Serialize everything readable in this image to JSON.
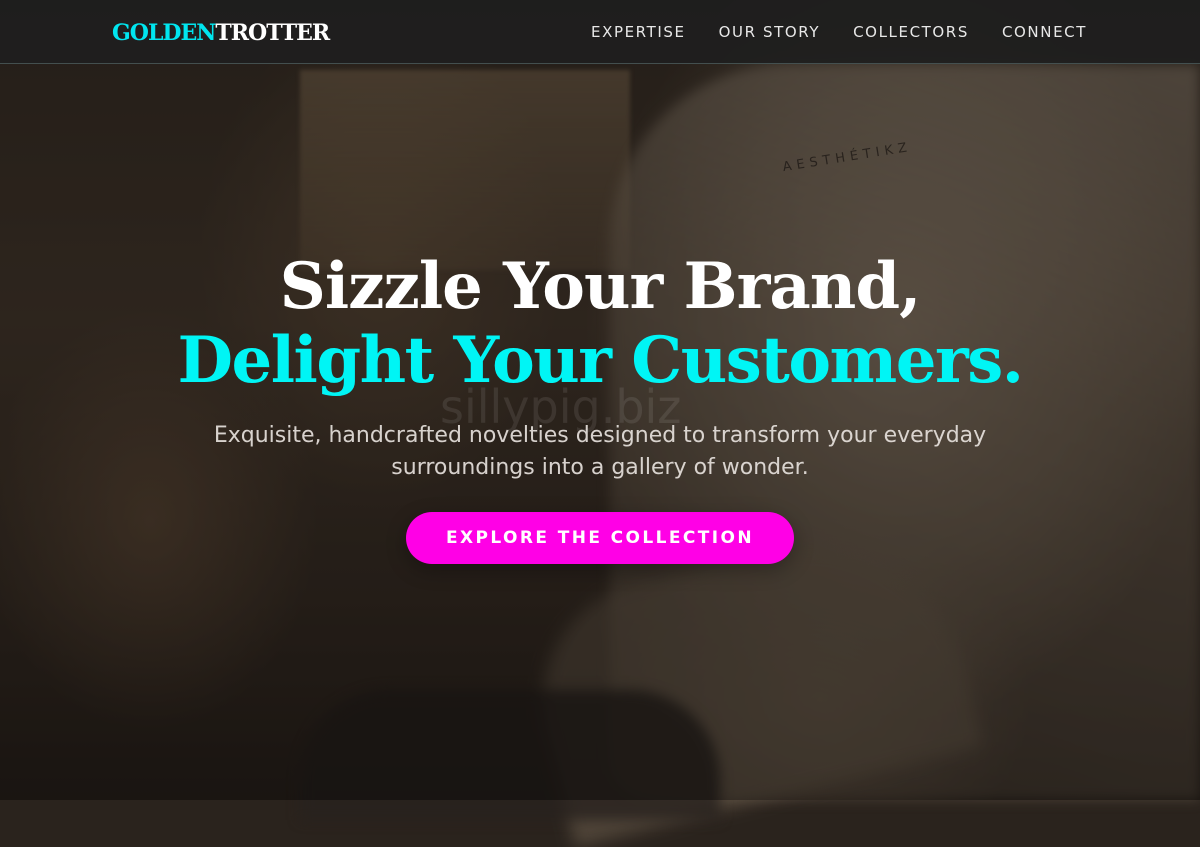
{
  "brand": {
    "logo_part1": "GOLDEN",
    "logo_part2": "TROTTER",
    "accent_color": "#00e6f0",
    "cta_color": "#ff00e6"
  },
  "nav": {
    "links": [
      {
        "label": "EXPERTISE"
      },
      {
        "label": "OUR STORY"
      },
      {
        "label": "COLLECTORS"
      },
      {
        "label": "CONNECT"
      }
    ]
  },
  "hero": {
    "headline_line1": "Sizzle Your Brand,",
    "headline_line2": "Delight Your Customers.",
    "subtitle": "Exquisite, handcrafted novelties designed to transform your everyday surroundings into a gallery of wonder.",
    "cta_label": "EXPLORE THE COLLECTION",
    "image_print_text": "AESTHÉTIKZ",
    "watermark": "sillypig.biz"
  }
}
